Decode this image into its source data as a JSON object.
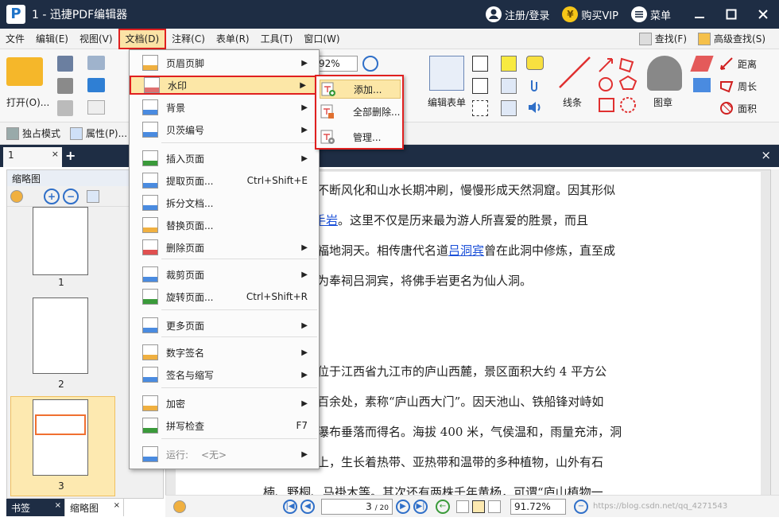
{
  "titlebar": {
    "title": "1 - 迅捷PDF编辑器",
    "login": "注册/登录",
    "vip": "购买VIP",
    "menu": "菜单",
    "logo_letter": "P",
    "vip_glyph": "¥",
    "login_icon": "user-icon",
    "menu_icon": "hamburger-icon"
  },
  "menubar": {
    "items": [
      "文件",
      "编辑(E)",
      "视图(V)",
      "文档(D)",
      "注释(C)",
      "表单(R)",
      "工具(T)",
      "窗口(W)"
    ],
    "find": "查找(F)",
    "advanced_find": "高级查找(S)"
  },
  "ribbon": {
    "open": "打开(O)...",
    "zoom_value": "92%",
    "edit_form": "编辑表单",
    "line": "线条",
    "stamp": "图章",
    "distance": "距离",
    "perimeter": "周长",
    "area": "面积"
  },
  "subbar": {
    "exclusive_mode": "独占模式",
    "properties": "属性(P)..."
  },
  "tabs": {
    "doc_tab": "1",
    "close": "×",
    "add": "+"
  },
  "sidepanel": {
    "title": "缩略图",
    "thumbs": [
      "1",
      "2",
      "3"
    ],
    "bottom_tabs": [
      "书签",
      "缩略图"
    ]
  },
  "document": {
    "lines": [
      {
        "parts": [
          {
            "t": "不断风化和山水长期冲刷，慢慢形成天然洞窟。因其形似"
          }
        ]
      },
      {
        "parts": [
          {
            "t": "名"
          },
          {
            "t": "佛手岩",
            "link": true
          },
          {
            "t": "。这里不仅是历来最为游人所喜爱的胜景，而且"
          }
        ]
      },
      {
        "parts": [
          {
            "t": "福地洞天。相传唐代名道"
          },
          {
            "t": "吕洞宾",
            "link": true
          },
          {
            "t": "曾在此洞中修炼，直至成"
          }
        ]
      },
      {
        "parts": [
          {
            "t": "为奉祠吕洞宾，将佛手岩更名为仙人洞。"
          }
        ]
      },
      {
        "parts": [
          {
            "t": "位于江西省九江市的庐山西麓，景区面积大约 4 平方公"
          }
        ]
      },
      {
        "parts": [
          {
            "t": "百余处，素称“庐山西大门”。因天池山、铁船锋对峙如"
          }
        ]
      },
      {
        "parts": [
          {
            "t": "瀑布垂落而得名。海拔 400 米，气侯温和，雨量充沛，洞"
          }
        ]
      },
      {
        "parts": [
          {
            "t": "上，生长着热带、亚热带和温带的多种植物，山外有石"
          }
        ]
      },
      {
        "parts": [
          {
            "t": "楠、野桐、马褂木等。其次还有两株千年黄杨，可谓“庐山植物一"
          }
        ]
      }
    ]
  },
  "statusbar": {
    "page_value": "3",
    "page_total": "/ 20",
    "zoom": "91.72%",
    "watermark": "https://blog.csdn.net/qq_42715430"
  },
  "doc_menu": {
    "items": [
      {
        "label": "页眉页脚",
        "shortcut": "",
        "submenu": true,
        "icon": "header-footer-icon"
      },
      {
        "label": "水印",
        "shortcut": "",
        "submenu": true,
        "icon": "watermark-icon"
      },
      {
        "label": "背景",
        "shortcut": "",
        "submenu": true,
        "icon": "background-icon"
      },
      {
        "label": "贝茨编号",
        "shortcut": "",
        "submenu": true,
        "icon": "bates-number-icon"
      },
      {
        "label": "插入页面",
        "shortcut": "",
        "submenu": true,
        "icon": "insert-page-icon"
      },
      {
        "label": "提取页面...",
        "shortcut": "Ctrl+Shift+E",
        "submenu": false,
        "icon": "extract-page-icon"
      },
      {
        "label": "拆分文档...",
        "shortcut": "",
        "submenu": false,
        "icon": "split-document-icon"
      },
      {
        "label": "替换页面...",
        "shortcut": "",
        "submenu": false,
        "icon": "replace-page-icon"
      },
      {
        "label": "删除页面",
        "shortcut": "",
        "submenu": true,
        "icon": "delete-page-icon"
      },
      {
        "label": "裁剪页面",
        "shortcut": "",
        "submenu": true,
        "icon": "crop-page-icon"
      },
      {
        "label": "旋转页面...",
        "shortcut": "Ctrl+Shift+R",
        "submenu": false,
        "icon": "rotate-page-icon"
      },
      {
        "label": "更多页面",
        "shortcut": "",
        "submenu": true,
        "icon": "more-pages-icon"
      },
      {
        "label": "数字签名",
        "shortcut": "",
        "submenu": true,
        "icon": "digital-signature-icon"
      },
      {
        "label": "签名与缩写",
        "shortcut": "",
        "submenu": true,
        "icon": "sign-initial-icon"
      },
      {
        "label": "加密",
        "shortcut": "",
        "submenu": true,
        "icon": "encrypt-icon"
      },
      {
        "label": "拼写检查",
        "shortcut": "F7",
        "submenu": false,
        "icon": "spell-check-icon"
      },
      {
        "label": "运行:",
        "shortcut": "",
        "submenu": true,
        "icon": "run-icon",
        "run_value": "<无>"
      }
    ]
  },
  "watermark_submenu": {
    "items": [
      "添加...",
      "全部删除...",
      "管理..."
    ]
  },
  "colors": {
    "title_bg": "#1e2d44",
    "highlight": "#fce7a7",
    "red_outline": "#e02020",
    "link": "#1a4fd8"
  }
}
